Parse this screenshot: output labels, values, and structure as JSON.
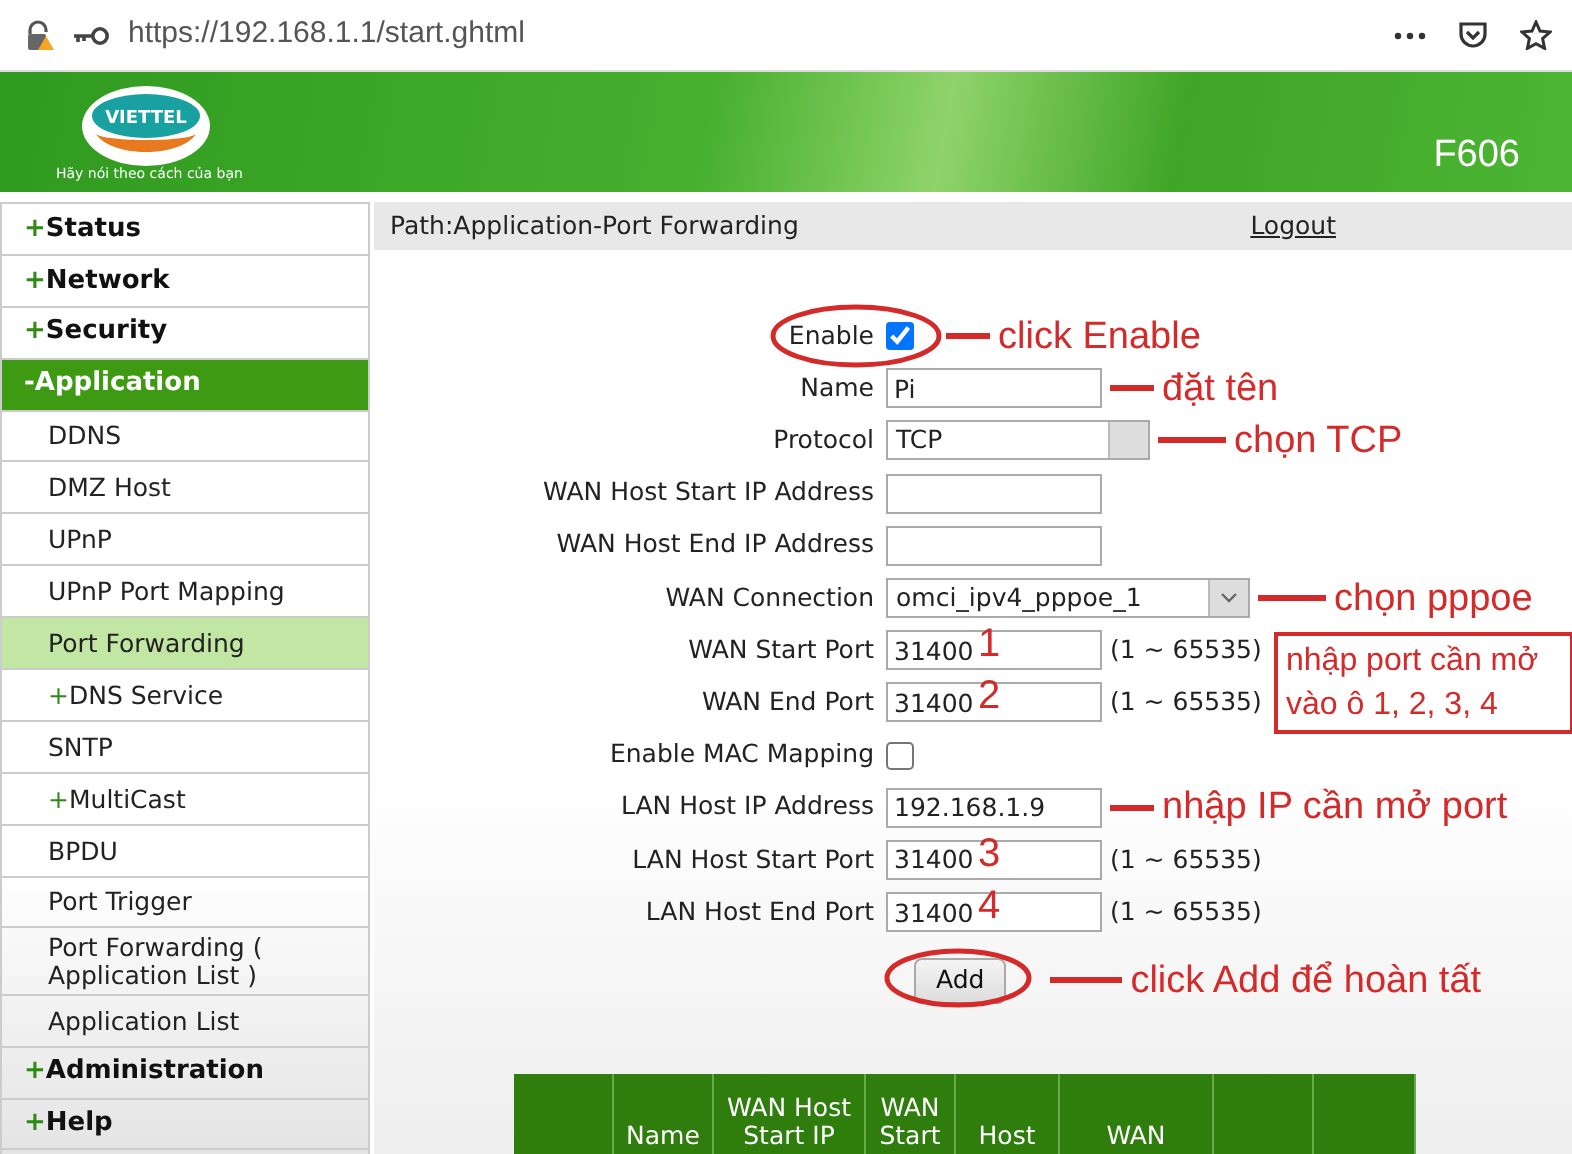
{
  "browser": {
    "url": "https://192.168.1.1/start.ghtml"
  },
  "banner": {
    "logo_text": "VIETTEL",
    "tagline": "Hãy nói theo cách của bạn",
    "model": "F606"
  },
  "sidebar": {
    "items": [
      {
        "kind": "section",
        "marker": "+",
        "label": "Status",
        "expanded": false,
        "selected": false
      },
      {
        "kind": "section",
        "marker": "+",
        "label": "Network",
        "expanded": false,
        "selected": false
      },
      {
        "kind": "section",
        "marker": "+",
        "label": "Security",
        "expanded": false,
        "selected": false
      },
      {
        "kind": "section",
        "marker": "-",
        "label": "Application",
        "expanded": true,
        "selected": false
      },
      {
        "kind": "sub",
        "label": "DDNS",
        "selected": false
      },
      {
        "kind": "sub",
        "label": "DMZ Host",
        "selected": false
      },
      {
        "kind": "sub",
        "label": "UPnP",
        "selected": false
      },
      {
        "kind": "sub",
        "label": "UPnP Port Mapping",
        "selected": false
      },
      {
        "kind": "sub",
        "label": "Port Forwarding",
        "selected": true
      },
      {
        "kind": "sub",
        "marker": "+",
        "label": "DNS Service",
        "selected": false
      },
      {
        "kind": "sub",
        "label": "SNTP",
        "selected": false
      },
      {
        "kind": "sub",
        "marker": "+",
        "label": "MultiCast",
        "selected": false
      },
      {
        "kind": "sub",
        "label": "BPDU",
        "selected": false
      },
      {
        "kind": "sub",
        "label": "Port Trigger",
        "selected": false
      },
      {
        "kind": "sub",
        "label": "Port Forwarding ( Application List )",
        "selected": false
      },
      {
        "kind": "sub",
        "label": "Application List",
        "selected": false
      },
      {
        "kind": "section",
        "marker": "+",
        "label": "Administration",
        "expanded": false,
        "selected": false
      },
      {
        "kind": "section",
        "marker": "+",
        "label": "Help",
        "expanded": false,
        "selected": false
      }
    ]
  },
  "path_bar": {
    "path": "Path:Application-Port Forwarding",
    "logout": "Logout"
  },
  "form": {
    "fields": [
      {
        "kind": "checkbox",
        "label": "Enable",
        "checked": true,
        "circled": true,
        "note": "click Enable"
      },
      {
        "kind": "text",
        "label": "Name",
        "value": "Pi",
        "note": "đặt tên"
      },
      {
        "kind": "select",
        "label": "Protocol",
        "value": "TCP",
        "note": "chọn TCP"
      },
      {
        "kind": "text",
        "label": "WAN Host Start IP Address"
      },
      {
        "kind": "text",
        "label": "WAN Host End IP Address"
      },
      {
        "kind": "select",
        "label": "WAN Connection",
        "value": "omci_ipv4_pppoe_1",
        "wide": true,
        "note": "chọn pppoe"
      },
      {
        "kind": "text",
        "label": "WAN Start Port",
        "value": "31400",
        "marker": "1",
        "hint": "(1 ~ 65535)"
      },
      {
        "kind": "text",
        "label": "WAN End Port",
        "value": "31400",
        "marker": "2",
        "hint": "(1 ~ 65535)"
      },
      {
        "kind": "checkbox",
        "label": "Enable MAC Mapping",
        "checked": false
      },
      {
        "kind": "text",
        "label": "LAN Host IP Address",
        "value": "192.168.1.9",
        "note": "nhập IP cần mở port"
      },
      {
        "kind": "text",
        "label": "LAN Host Start Port",
        "value": "31400",
        "marker": "3",
        "hint": "(1 ~ 65535)"
      },
      {
        "kind": "text",
        "label": "LAN Host End Port",
        "value": "31400",
        "marker": "4",
        "hint": "(1 ~ 65535)"
      }
    ],
    "add_button": {
      "label": "Add",
      "circled": true,
      "note": "click Add để hoàn tất"
    },
    "boxed_note": "nhập port cần mở vào ô 1, 2, 3, 4"
  },
  "table": {
    "columns": [
      {},
      {
        "label": "Name"
      },
      {
        "label": "WAN Host Start IP"
      },
      {
        "label": "WAN Start"
      },
      {
        "label": "Host"
      },
      {
        "label": "WAN"
      },
      {},
      {}
    ]
  }
}
